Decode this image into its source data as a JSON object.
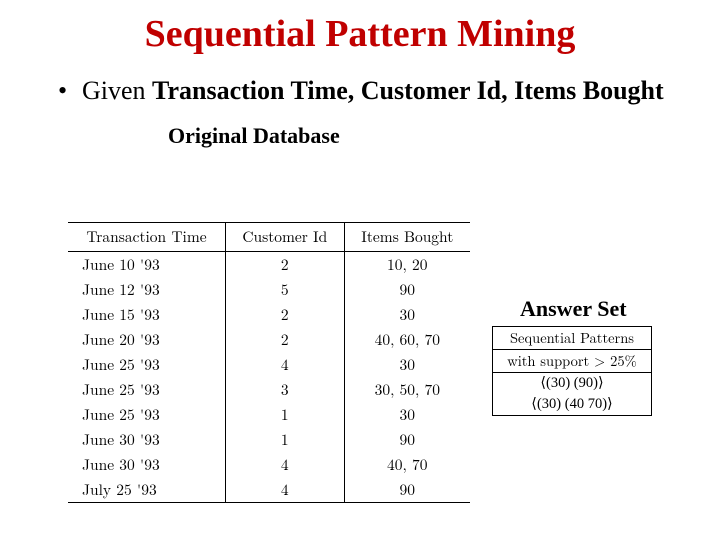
{
  "title": "Sequential Pattern Mining",
  "bullet": {
    "prefix": "Given ",
    "bold": "Transaction Time, Customer Id, Items Bought"
  },
  "table1": {
    "caption": "Original Database",
    "headers": [
      "Transaction Time",
      "Customer Id",
      "Items Bought"
    ],
    "rows": [
      [
        "June 10 '93",
        "2",
        "10, 20"
      ],
      [
        "June 12 '93",
        "5",
        "90"
      ],
      [
        "June 15 '93",
        "2",
        "30"
      ],
      [
        "June 20 '93",
        "2",
        "40, 60, 70"
      ],
      [
        "June 25 '93",
        "4",
        "30"
      ],
      [
        "June 25 '93",
        "3",
        "30, 50, 70"
      ],
      [
        "June 25 '93",
        "1",
        "30"
      ],
      [
        "June 30 '93",
        "1",
        "90"
      ],
      [
        "June 30 '93",
        "4",
        "40, 70"
      ],
      [
        "July 25 '93",
        "4",
        "90"
      ]
    ]
  },
  "table2": {
    "caption": "Answer Set",
    "header_line1": "Sequential Patterns",
    "header_line2": "with support > 25%",
    "rows": [
      "⟨(30) (90)⟩",
      "⟨(30) (40 70)⟩"
    ]
  }
}
